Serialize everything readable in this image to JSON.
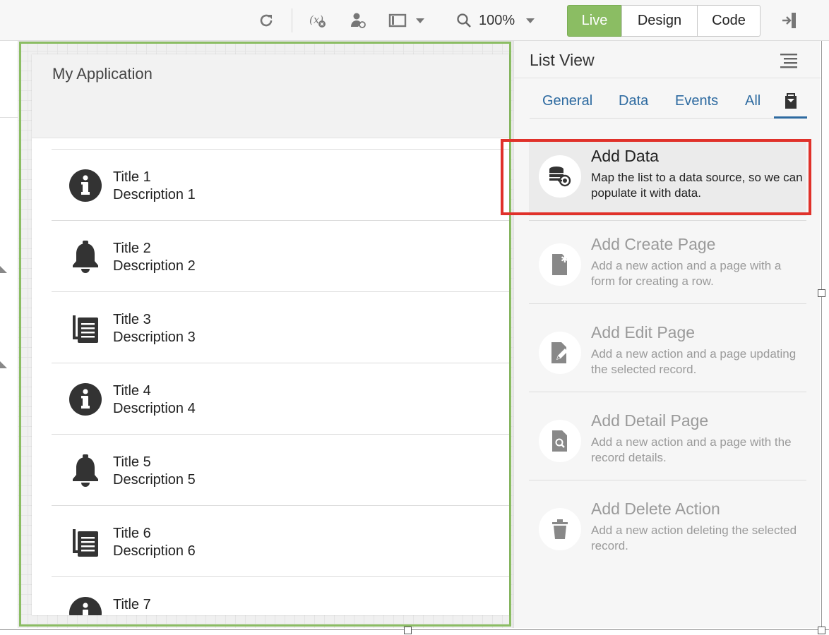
{
  "toolbar": {
    "zoom": "100%",
    "modes": {
      "live": "Live",
      "design": "Design",
      "code": "Code"
    }
  },
  "app": {
    "title": "My Application",
    "items": [
      {
        "title": "Title 1",
        "description": "Description 1",
        "icon": "info-icon"
      },
      {
        "title": "Title 2",
        "description": "Description 2",
        "icon": "bell-icon"
      },
      {
        "title": "Title 3",
        "description": "Description 3",
        "icon": "document-icon"
      },
      {
        "title": "Title 4",
        "description": "Description 4",
        "icon": "info-icon"
      },
      {
        "title": "Title 5",
        "description": "Description 5",
        "icon": "bell-icon"
      },
      {
        "title": "Title 6",
        "description": "Description 6",
        "icon": "document-icon"
      },
      {
        "title": "Title 7",
        "description": "",
        "icon": "info-icon"
      }
    ]
  },
  "panel": {
    "title": "List View",
    "tabs": [
      "General",
      "Data",
      "Events",
      "All"
    ],
    "quick_starts": [
      {
        "title": "Add Data",
        "description": "Map the list to a data source, so we can populate it with data.",
        "icon": "database-link-icon"
      },
      {
        "title": "Add Create Page",
        "description": "Add a new action and a page with a form for creating a row.",
        "icon": "new-page-icon"
      },
      {
        "title": "Add Edit Page",
        "description": "Add a new action and a page updating the selected record.",
        "icon": "edit-page-icon"
      },
      {
        "title": "Add Detail Page",
        "description": "Add a new action and a page with the record details.",
        "icon": "detail-page-icon"
      },
      {
        "title": "Add Delete Action",
        "description": "Add a new action deleting the selected record.",
        "icon": "trash-icon"
      }
    ]
  },
  "colors": {
    "live_green": "#8bbd63",
    "tab_blue": "#2d6aa0",
    "highlight_red": "#e0312a"
  }
}
